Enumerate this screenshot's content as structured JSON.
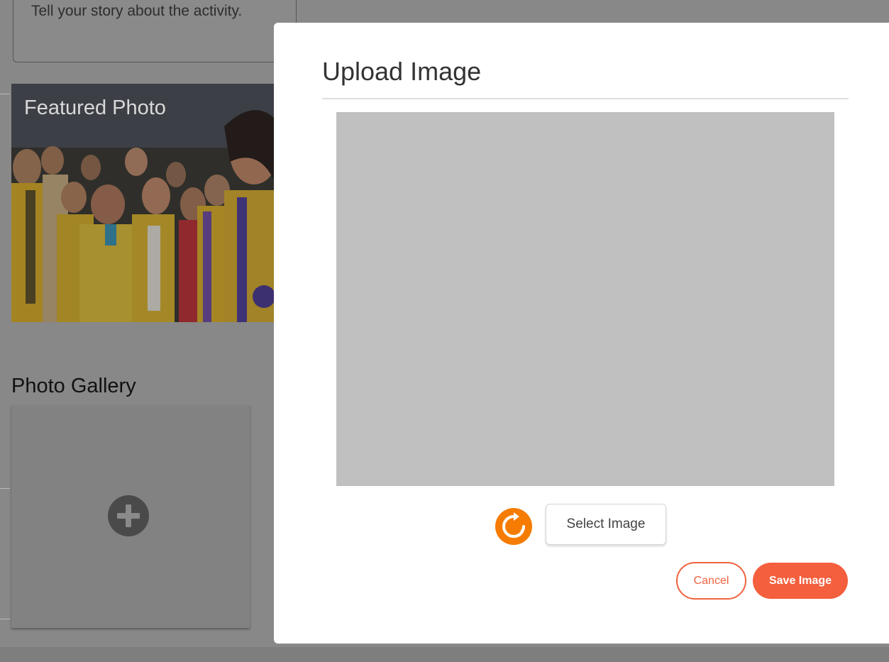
{
  "background": {
    "story_placeholder": "Tell your story about the activity.",
    "featured_label": "Featured Photo",
    "gallery_title": "Photo Gallery",
    "gallery_add_icon": "plus-circle-icon"
  },
  "modal": {
    "title": "Upload Image",
    "rotate_icon": "rotate-icon",
    "select_label": "Select Image",
    "cancel_label": "Cancel",
    "save_label": "Save Image"
  },
  "colors": {
    "accent": "#f45f3d",
    "rotate": "#f57c00",
    "preview_bg": "#c0c0c0",
    "overlay": "#888888"
  }
}
